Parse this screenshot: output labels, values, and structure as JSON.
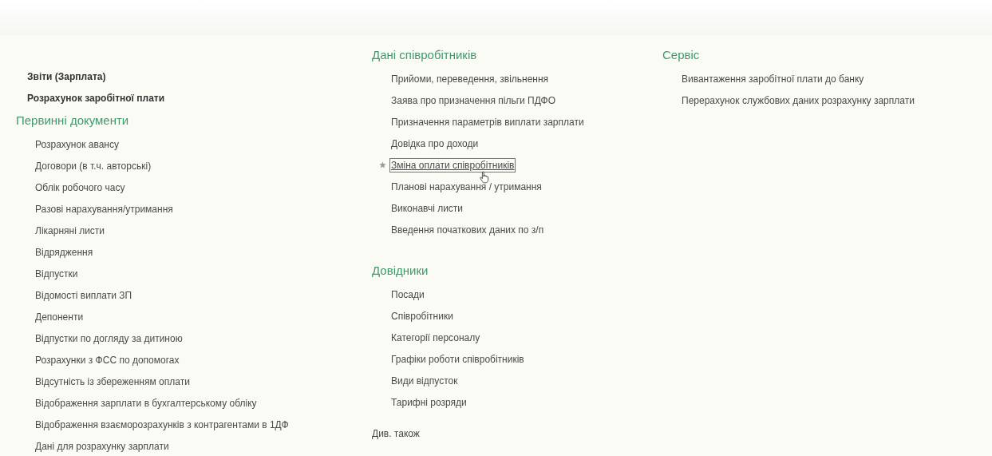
{
  "columns": [
    {
      "commands": [
        {
          "label": "Звіти (Зарплата)"
        },
        {
          "label": "Розрахунок заробітної плати"
        }
      ],
      "sections": [
        {
          "title": "Первинні документи",
          "items": [
            {
              "label": "Розрахунок авансу",
              "focused": false
            },
            {
              "label": "Договори (в т.ч. авторські)",
              "focused": false
            },
            {
              "label": "Облік робочого часу",
              "focused": false
            },
            {
              "label": "Разові нарахування/утримання",
              "focused": false
            },
            {
              "label": "Лікарняні листи",
              "focused": false
            },
            {
              "label": "Відрядження",
              "focused": false
            },
            {
              "label": "Відпустки",
              "focused": false
            },
            {
              "label": "Відомості виплати ЗП",
              "focused": false
            },
            {
              "label": "Депоненти",
              "focused": false
            },
            {
              "label": "Відпустки по догляду за дитиною",
              "focused": false
            },
            {
              "label": "Розрахунки з ФСС по допомогах",
              "focused": false
            },
            {
              "label": "Відсутність із збереженням оплати",
              "focused": false
            },
            {
              "label": "Відображення зарплати в бухгалтерському обліку",
              "focused": false
            },
            {
              "label": "Відображення взаєморозрахунків з контрагентами в 1ДФ",
              "focused": false
            },
            {
              "label": "Дані для розрахунку зарплати",
              "focused": false
            }
          ]
        }
      ]
    },
    {
      "sections": [
        {
          "title": "Дані співробітників",
          "items": [
            {
              "label": "Прийоми, переведення, звільнення",
              "focused": false
            },
            {
              "label": "Заява про призначення пільги ПДФО",
              "focused": false
            },
            {
              "label": "Призначення параметрів виплати зарплати",
              "focused": false
            },
            {
              "label": "Довідка про доходи",
              "focused": false
            },
            {
              "label": "Зміна оплати співробітників",
              "focused": true
            },
            {
              "label": "Планові нарахування / утримання",
              "focused": false
            },
            {
              "label": "Виконавчі листи",
              "focused": false
            },
            {
              "label": "Введення початкових даних по з/п",
              "focused": false
            }
          ]
        },
        {
          "title": "Довідники",
          "items": [
            {
              "label": "Посади",
              "focused": false
            },
            {
              "label": "Співробітники",
              "focused": false
            },
            {
              "label": "Категорії персоналу",
              "focused": false
            },
            {
              "label": "Графіки роботи співробітників",
              "focused": false
            },
            {
              "label": "Види відпусток",
              "focused": false
            },
            {
              "label": "Тарифні розряди",
              "focused": false
            }
          ]
        }
      ],
      "see_also": "Див. також"
    },
    {
      "sections": [
        {
          "title": "Сервіс",
          "items": [
            {
              "label": "Вивантаження заробітної плати до банку",
              "focused": false
            },
            {
              "label": "Перерахунок службових даних розрахунку зарплати",
              "focused": false
            }
          ]
        }
      ]
    }
  ]
}
